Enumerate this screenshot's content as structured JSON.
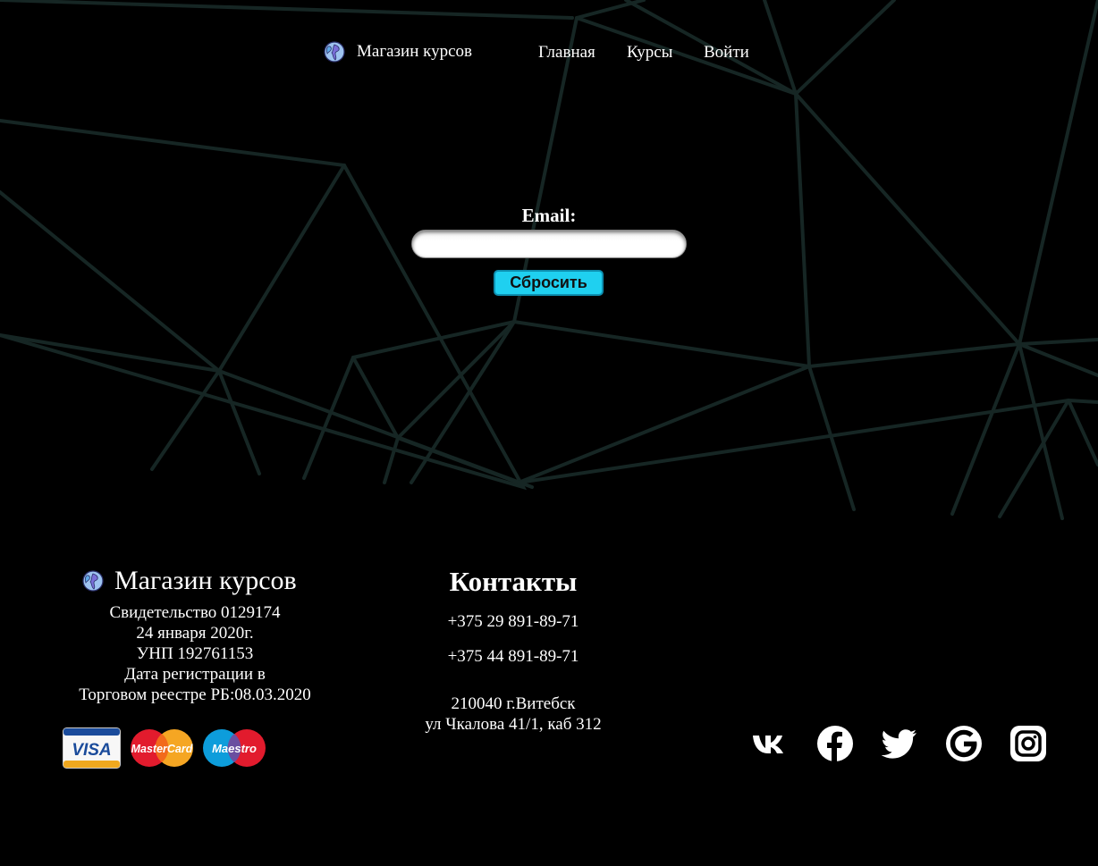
{
  "header": {
    "brand_icon": "globe-icon",
    "brand": "Магазин курсов",
    "nav": {
      "home": "Главная",
      "courses": "Курсы",
      "login": "Войти"
    }
  },
  "form": {
    "email_label": "Email:",
    "email_value": "",
    "reset_label": "Сбросить",
    "reset_color": "#1fd0f0"
  },
  "footer": {
    "brand": "Магазин курсов",
    "info": {
      "certificate": "Свидетельство 0129174",
      "date": "24 января 2020г.",
      "unp": "УНП 192761153",
      "registration_1": "Дата регистрации в",
      "registration_2": "Торговом реестре РБ:08.03.2020"
    },
    "payments": {
      "visa": "VISA",
      "mastercard": "MasterCard",
      "maestro": "Maestro"
    },
    "contacts": {
      "title": "Контакты",
      "phone_1": "+375 29 891-89-71",
      "phone_2": "+375 44 891-89-71",
      "address_1": "210040 г.Витебск",
      "address_2": "ул Чкалова 41/1, каб 312"
    },
    "socials": [
      "vk-icon",
      "facebook-icon",
      "twitter-icon",
      "google-icon",
      "instagram-icon"
    ]
  },
  "colors": {
    "background": "#000000",
    "lines": "#162624"
  }
}
